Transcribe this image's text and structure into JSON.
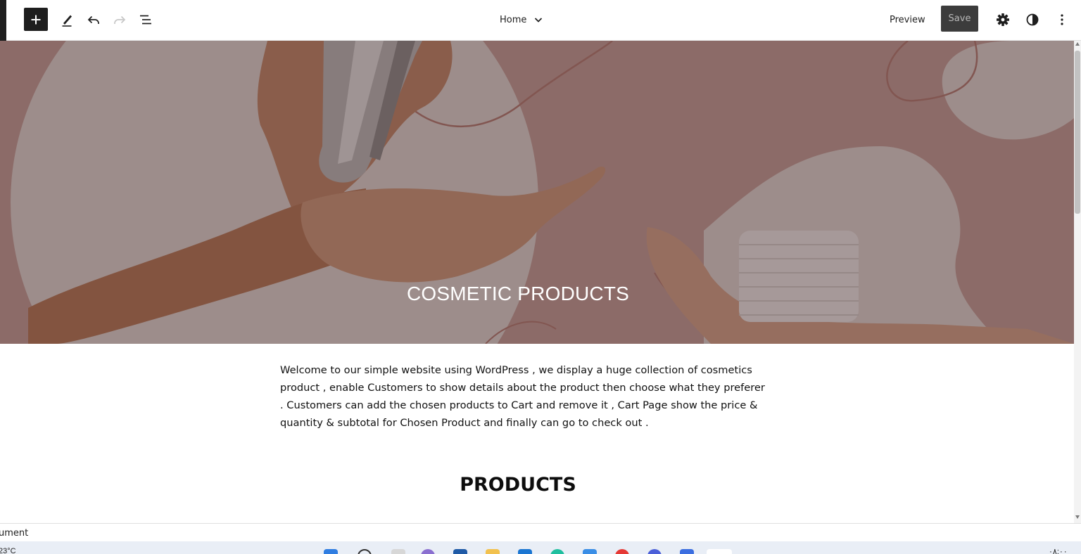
{
  "toolbar": {
    "document_title": "Home",
    "preview_label": "Preview",
    "save_label": "Save"
  },
  "cover": {
    "title": "COSMETIC PRODUCTS"
  },
  "content": {
    "intro_paragraph": "Welcome to our simple website using WordPress , we display a huge collection of cosmetics product , enable Customers to show details about the product then choose what they preferer . Customers can add the chosen products to Cart and remove it , Cart Page show the price & quantity & subtotal for Chosen Product and finally can go to check out .",
    "products_heading": "PRODUCTS"
  },
  "footer": {
    "breadcrumb": "ument"
  },
  "taskbar": {
    "weather": "23°C",
    "clock": "٠٨:٠٠"
  },
  "icons": {
    "add": "plus-icon",
    "tools": "pencil-icon",
    "undo": "undo-icon",
    "redo": "redo-icon",
    "list_view": "list-view-icon",
    "dropdown": "chevron-down-icon",
    "settings": "gear-icon",
    "styles": "half-circle-icon",
    "options": "vertical-ellipsis-icon"
  },
  "colors": {
    "toolbar_dark": "#1e1e1e",
    "save_button_bg": "#3c3c3c",
    "save_button_text": "#b9b9b9",
    "cover_overlay": "#8a6f6f"
  }
}
